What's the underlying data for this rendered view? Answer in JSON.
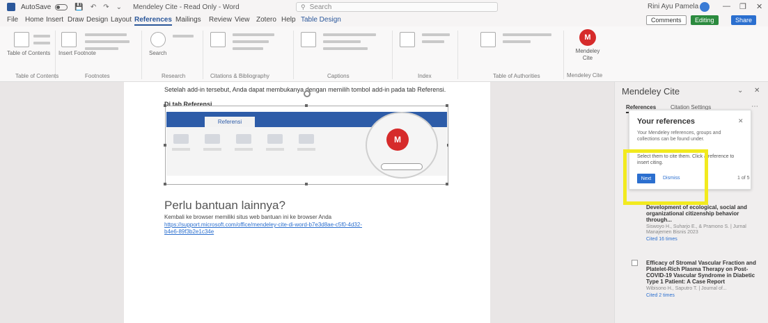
{
  "titlebar": {
    "autosave_label": "AutoSave",
    "document_name": "Mendeley Cite - Read Only - Word",
    "search_placeholder": "Search",
    "user_name": "Rini Ayu Pamela",
    "window_controls": [
      "—",
      "❐",
      "✕"
    ]
  },
  "menu": {
    "tabs": [
      "File",
      "Home",
      "Insert",
      "Draw",
      "Design",
      "Layout",
      "References",
      "Mailings",
      "Review",
      "View",
      "Zotero",
      "Help",
      "Table Design"
    ],
    "active_tab": "References",
    "comments_label": "Comments",
    "editing_label": "Editing",
    "share_label": "Share"
  },
  "ribbon": {
    "groups": [
      {
        "label": "Table of Contents"
      },
      {
        "label": "Footnotes"
      },
      {
        "label": "Research"
      },
      {
        "label": "Citations & Bibliography"
      },
      {
        "label": "Captions"
      },
      {
        "label": "Index"
      },
      {
        "label": "Table of Authorities"
      },
      {
        "label": "Mendeley Cite"
      }
    ],
    "toc_button": "Table of Contents",
    "insert_footnote": "Insert Footnote",
    "search_button": "Search",
    "mendeley_label_line1": "Mendeley",
    "mendeley_label_line2": "Cite",
    "mendeley_logo_text": "M"
  },
  "document": {
    "intro_text": "Setelah add-in tersebut, Anda dapat membukanya dengan memilih tombol add-in pada tab Referensi.",
    "section_heading": "Di tab Referensi",
    "image_tab_label": "Referensi",
    "help_heading": "Perlu bantuan lainnya?",
    "help_text": "Kembali ke browser memiliki situs web bantuan ini ke browser Anda",
    "help_link": "https://support.microsoft.com/office/mendeley-cite-di-word-b7e3d8ae-c5f0-4d32-b4e6-89f3b2e1c34e"
  },
  "pane": {
    "title": "Mendeley Cite",
    "tabs": [
      "References",
      "Citation Settings"
    ],
    "active_tab": "References",
    "popup": {
      "title": "Your references",
      "text": "Your Mendeley references, groups and collections can be found under.",
      "text2": "Select them to cite them. Click a reference to insert citing.",
      "next_label": "Next",
      "dismiss_label": "Dismiss",
      "page_label": "1 of 5"
    },
    "references": [
      {
        "title": "Development of ecological, social and organizational citizenship behavior through...",
        "meta": "Siswoyo H., Suharjo E., & Pramono S. | Jurnal Manajemen Bisnis 2023",
        "link": "Cited 16 times"
      },
      {
        "title": "Efficacy of Stromal Vascular Fraction and Platelet-Rich Plasma Therapy on Post-COVID-19 Vascular Syndrome in Diabetic Type 1 Patient: A Case Report",
        "meta": "Wibisono H., Saputro T. | Journal of...",
        "link": "Cited 2 times"
      }
    ]
  }
}
